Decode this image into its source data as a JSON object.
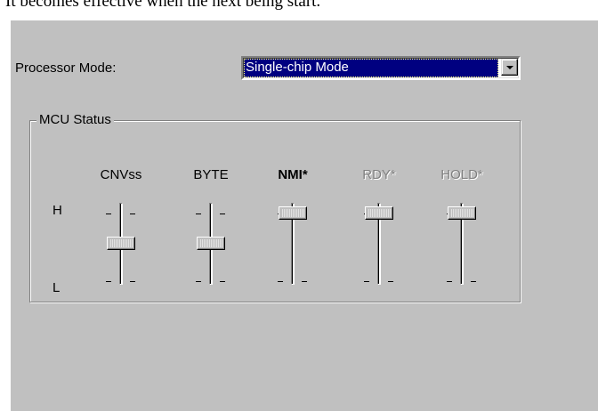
{
  "document": {
    "caption_fragment": "It becomes effective when the next being start."
  },
  "dialog": {
    "processor_mode": {
      "label": "Processor Mode:",
      "selected_value": "Single-chip Mode"
    },
    "mcu_status": {
      "title": "MCU Status",
      "high_label": "H",
      "low_label": "L",
      "sliders": [
        {
          "label": "CNVss",
          "state": "L",
          "enabled": true
        },
        {
          "label": "BYTE",
          "state": "L",
          "enabled": true
        },
        {
          "label": "NMI*",
          "state": "H",
          "enabled": true
        },
        {
          "label": "RDY*",
          "state": "H",
          "enabled": false
        },
        {
          "label": "HOLD*",
          "state": "H",
          "enabled": false
        }
      ]
    }
  },
  "colors": {
    "dialog_bg": "#c0c0c0",
    "selection_bg": "#000080",
    "disabled_text": "#808080"
  }
}
